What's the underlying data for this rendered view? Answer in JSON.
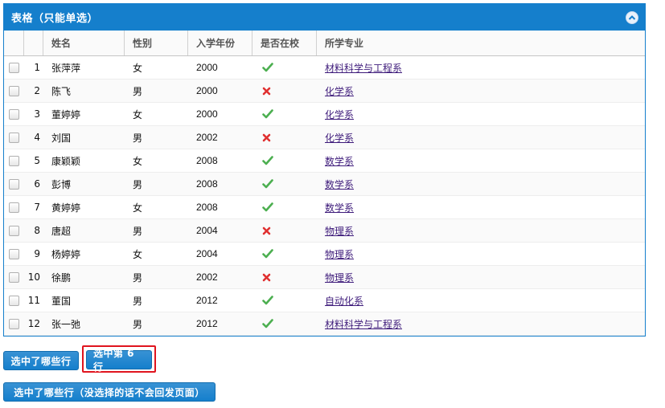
{
  "panel": {
    "title": "表格（只能单选）"
  },
  "columns": [
    "姓名",
    "性别",
    "入学年份",
    "是否在校",
    "所学专业"
  ],
  "rows": [
    {
      "num": "1",
      "name": "张萍萍",
      "gender": "女",
      "year": "2000",
      "enrolled": true,
      "major": "材料科学与工程系"
    },
    {
      "num": "2",
      "name": "陈飞",
      "gender": "男",
      "year": "2000",
      "enrolled": false,
      "major": "化学系"
    },
    {
      "num": "3",
      "name": "董婷婷",
      "gender": "女",
      "year": "2000",
      "enrolled": true,
      "major": "化学系"
    },
    {
      "num": "4",
      "name": "刘国",
      "gender": "男",
      "year": "2002",
      "enrolled": false,
      "major": "化学系"
    },
    {
      "num": "5",
      "name": "康颖颖",
      "gender": "女",
      "year": "2008",
      "enrolled": true,
      "major": "数学系"
    },
    {
      "num": "6",
      "name": "彭博",
      "gender": "男",
      "year": "2008",
      "enrolled": true,
      "major": "数学系"
    },
    {
      "num": "7",
      "name": "黄婷婷",
      "gender": "女",
      "year": "2008",
      "enrolled": true,
      "major": "数学系"
    },
    {
      "num": "8",
      "name": "唐超",
      "gender": "男",
      "year": "2004",
      "enrolled": false,
      "major": "物理系"
    },
    {
      "num": "9",
      "name": "杨婷婷",
      "gender": "女",
      "year": "2004",
      "enrolled": true,
      "major": "物理系"
    },
    {
      "num": "10",
      "name": "徐鹏",
      "gender": "男",
      "year": "2002",
      "enrolled": false,
      "major": "物理系"
    },
    {
      "num": "11",
      "name": "董国",
      "gender": "男",
      "year": "2012",
      "enrolled": true,
      "major": "自动化系"
    },
    {
      "num": "12",
      "name": "张一弛",
      "gender": "男",
      "year": "2012",
      "enrolled": true,
      "major": "材料科学与工程系"
    }
  ],
  "buttons": {
    "which_rows": "选中了哪些行",
    "select_row6": "选中第 6 行",
    "which_rows_no_postback": "选中了哪些行（没选择的话不会回发页面）"
  },
  "colors": {
    "accent": "#157fcc",
    "check": "#4caf50",
    "cross": "#e03030",
    "highlight": "#e0141e"
  }
}
